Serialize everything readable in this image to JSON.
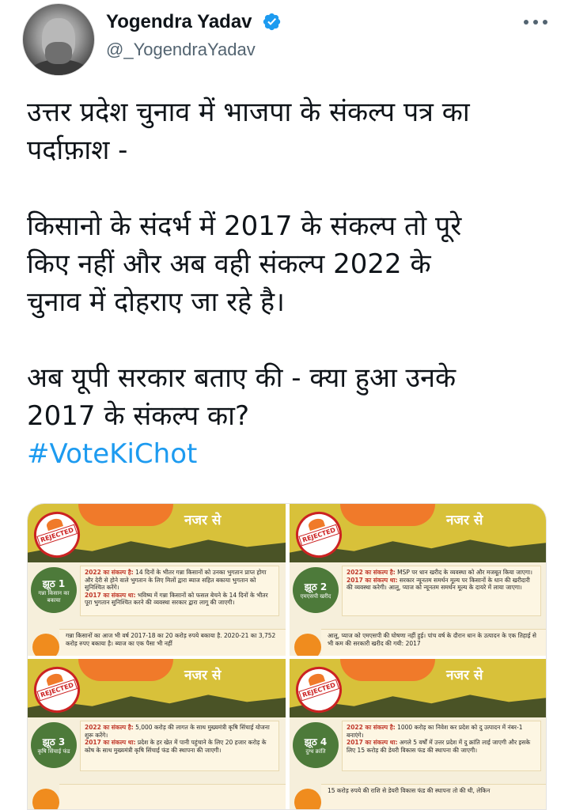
{
  "user": {
    "display_name": "Yogendra Yadav",
    "handle": "@_YogendraYadav",
    "verified": true,
    "avatar_icon": "profile-photo"
  },
  "menu": {
    "icon": "more-horizontal-icon"
  },
  "tweet": {
    "para1_line1": "उत्तर प्रदेश चुनाव में भाजपा के संकल्प पत्र का",
    "para1_line2": "पर्दाफ़ाश -",
    "para2_line1": "किसानो के संदर्भ में 2017 के संकल्प तो पूरे",
    "para2_line2": "किए नहीं और अब वही संकल्प 2022 के",
    "para2_line3": "चुनाव में दोहराए जा रहे है।",
    "para3_line1": "अब यूपी सरकार बताए की - क्या हुआ उनके",
    "para3_line2": "2017 के संकल्प का?",
    "hashtag": "#VoteKiChot"
  },
  "colors": {
    "link": "#1d9bf0",
    "verified": "#1d9bf0",
    "text": "#0f1419",
    "secondary": "#536471"
  },
  "media": {
    "panels": [
      {
        "heading": "नजर से",
        "stamp": "REJECTED",
        "tag_title": "झूठ 1",
        "tag_sub": "गन्ना किसान का बकाया",
        "promise_2022_label": "2022 का संकल्प है:",
        "promise_2022": "14 दिनों के भीतर गन्ना किसानों को उनका भुगतान प्राप्त होगा और देरी से होने वाले भुगतान के लिए मिलों द्वारा ब्याज सहित बकाया भुगतान को सुनिश्चित करेंगे।",
        "promise_2017_label": "2017 का संकल्प था:",
        "promise_2017": "भविष्य में गन्ना किसानों को फसल बेचने के 14 दिनों के भीतर पूरा भुगतान सुनिश्चित करने की व्यवस्था सरकार द्वारा लागू की जाएगी।",
        "footer": "गन्ना किसानों का आज भी वर्ष 2017-18 का 20 करोड़ रुपये बकाया है. 2020-21 का 3,752 करोड़ रुपए बकाया है। ब्याज का एक पैसा भी नहीं"
      },
      {
        "heading": "नजर से",
        "stamp": "REJECTED",
        "tag_title": "झूठ 2",
        "tag_sub": "एमएसपी खरीद",
        "promise_2022_label": "2022 का संकल्प है:",
        "promise_2022": "MSP पर धान खरीद के व्यवस्था को और मजबूत किया जाएगा।",
        "promise_2017_label": "2017 का संकल्प था:",
        "promise_2017": "सरकार न्यूनतम समर्थन मूल्य पर किसानों के धान की खरीदारी की व्यवस्था करेगी। आलू, प्याज को न्यूनतम समर्थन मूल्य के दायरे में लाया जाएगा।",
        "footer": "आलू, प्याज को एमएसपी की घोषणा नहीं हुई। पांच वर्ष के दौरान धान के उत्पादन के एक तिहाई से भी कम की सरकारी खरीद की गयी: 2017"
      },
      {
        "heading": "नजर से",
        "stamp": "REJECTED",
        "tag_title": "झूठ 3",
        "tag_sub": "कृषि सिंचाई फंड",
        "promise_2022_label": "2022 का संकल्प है:",
        "promise_2022": "5,000 करोड़ की लागत के साथ मुख्यमंत्री कृषि सिंचाई योजना शुरू करेंगे।",
        "promise_2017_label": "2017 का संकल्प था:",
        "promise_2017": "प्रदेश के हर खेत में पानी पहुंचाने के लिए 20 हजार करोड़ के कोष के साथ मुख्यमंत्री कृषि सिंचाई फंड की स्थापना की जाएगी।",
        "footer": ""
      },
      {
        "heading": "नजर से",
        "stamp": "REJECTED",
        "tag_title": "झूठ 4",
        "tag_sub": "दुग्ध क्रांति",
        "promise_2022_label": "2022 का संकल्प है:",
        "promise_2022": "1000 करोड़ का निवेश कर प्रदेश को दु उत्पादन में नंबर-1 बनाएंगे।",
        "promise_2017_label": "2017 का संकल्प था:",
        "promise_2017": "अगले 5 वर्षों में उत्तर प्रदेश में दु क्रांति लाई जाएगी और इसके लिए 15 करोड़ की डेयरी विकास फंड की स्थापना की जाएगी।",
        "footer": "15 करोड़ रुपये की राशि से डेयरी विकास फंड की स्थापना तो की थी, लेकिन"
      }
    ]
  }
}
